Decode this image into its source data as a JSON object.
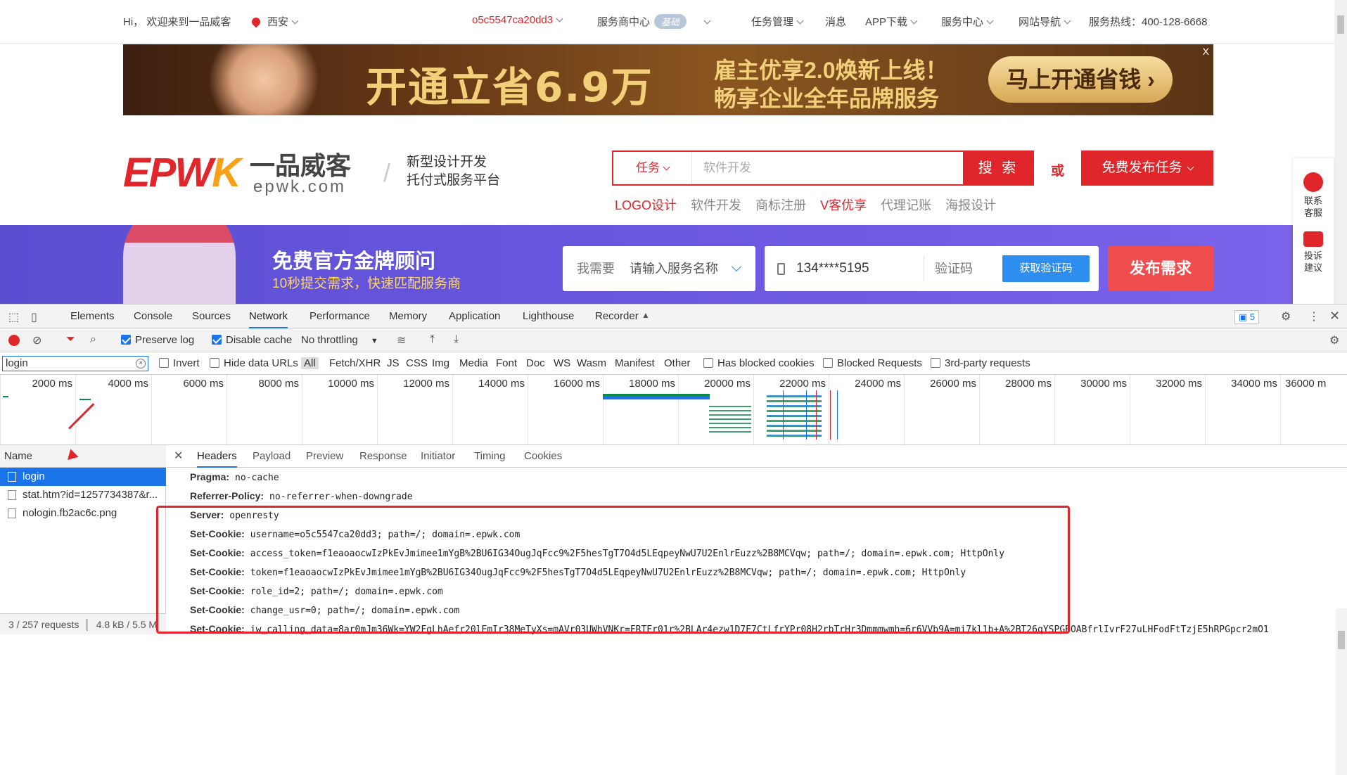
{
  "topnav": {
    "greeting": "Hi， 欢迎来到一品威客",
    "city": "西安",
    "username": "o5c5547ca20dd3",
    "merchant": "服务商中心",
    "merchant_badge": "基础",
    "task_mgmt": "任务管理",
    "messages": "消息",
    "app": "APP下载",
    "service": "服务中心",
    "sitenav": "网站导航",
    "hotline": "服务热线：400-128-6668"
  },
  "banner": {
    "headline": "开通立省6.9万",
    "line1": "雇主优享2.0焕新上线！",
    "line2": "畅享企业全年品牌服务",
    "cta": "马上开通省钱 ›",
    "close": "X"
  },
  "brand": {
    "logo_en_a": "EPW",
    "logo_en_b": "K",
    "logo_cn": "一品威客",
    "logo_url": "epwk.com",
    "slogan1": "新型设计开发",
    "slogan2": "托付式服务平台"
  },
  "search": {
    "category": "任务",
    "placeholder": "软件开发",
    "button": "搜 索",
    "or": "或",
    "publish": "免费发布任务"
  },
  "hotlinks": [
    "LOGO设计",
    "软件开发",
    "商标注册",
    "V客优享",
    "代理记账",
    "海报设计"
  ],
  "consult": {
    "title": "免费官方金牌顾问",
    "subtitle": "10秒提交需求，快速匹配服务商",
    "need_label": "我需要",
    "need_placeholder": "请输入服务名称",
    "phone": "134****5195",
    "code_label": "验证码",
    "get_code": "获取验证码",
    "submit": "发布需求"
  },
  "side": {
    "contact": "联系客服",
    "feedback": "投诉建议"
  },
  "devtools": {
    "tabs": [
      "Elements",
      "Console",
      "Sources",
      "Network",
      "Performance",
      "Memory",
      "Application",
      "Lighthouse",
      "Recorder"
    ],
    "active_tab": "Network",
    "issues_count": "5",
    "toolbar": {
      "preserve_log": "Preserve log",
      "disable_cache": "Disable cache",
      "throttling": "No throttling"
    },
    "filter": {
      "value": "login",
      "invert": "Invert",
      "hide_data_urls": "Hide data URLs",
      "types": [
        "All",
        "Fetch/XHR",
        "JS",
        "CSS",
        "Img",
        "Media",
        "Font",
        "Doc",
        "WS",
        "Wasm",
        "Manifest",
        "Other"
      ],
      "blocked_cookies": "Has blocked cookies",
      "blocked_requests": "Blocked Requests",
      "third_party": "3rd-party requests"
    },
    "timeline_ticks": [
      "2000 ms",
      "4000 ms",
      "6000 ms",
      "8000 ms",
      "10000 ms",
      "12000 ms",
      "14000 ms",
      "16000 ms",
      "18000 ms",
      "20000 ms",
      "22000 ms",
      "24000 ms",
      "26000 ms",
      "28000 ms",
      "30000 ms",
      "32000 ms",
      "34000 ms",
      "36000 m"
    ],
    "name_header": "Name",
    "requests": [
      "login",
      "stat.htm?id=1257734387&r...",
      "nologin.fb2ac6c.png"
    ],
    "footer": "3 / 257 requests",
    "footer_size": "4.8 kB / 5.5 M",
    "detail_tabs": [
      "Headers",
      "Payload",
      "Preview",
      "Response",
      "Initiator",
      "Timing",
      "Cookies"
    ],
    "headers": [
      {
        "k": "Pragma:",
        "v": "no-cache"
      },
      {
        "k": "Referrer-Policy:",
        "v": "no-referrer-when-downgrade"
      },
      {
        "k": "Server:",
        "v": "openresty"
      },
      {
        "k": "Set-Cookie:",
        "v": "username=o5c5547ca20dd3; path=/; domain=.epwk.com"
      },
      {
        "k": "Set-Cookie:",
        "v": "access_token=f1eaoaocwIzPkEvJmimee1mYgB%2BU6IG34OugJqFcc9%2F5hesTgT7O4d5LEqpeyNwU7U2EnlrEuzz%2B8MCVqw; path=/; domain=.epwk.com; HttpOnly"
      },
      {
        "k": "Set-Cookie:",
        "v": "token=f1eaoaocwIzPkEvJmimee1mYgB%2BU6IG34OugJqFcc9%2F5hesTgT7O4d5LEqpeyNwU7U2EnlrEuzz%2B8MCVqw; path=/; domain=.epwk.com; HttpOnly"
      },
      {
        "k": "Set-Cookie:",
        "v": "role_id=2; path=/; domain=.epwk.com"
      },
      {
        "k": "Set-Cookie:",
        "v": "change_usr=0; path=/; domain=.epwk.com"
      },
      {
        "k": "Set-Cookie:",
        "v": "iw_calling_data=8ar0mJm36Wk=YW2FgLhAefr20lEmIr38MeTyXs=mAVr03UWhVNKr=FRTEr01r%2BLAr4ezw1D7E7CtLfrYPr08H2rbTrHr3Dmmmwmh=6r6VVb9A=mi7kl1b+A%2BT26qYSPGBOABfrlIvrF27uLHFodFtTzjE5hRPGpcr2mO1"
      }
    ]
  }
}
